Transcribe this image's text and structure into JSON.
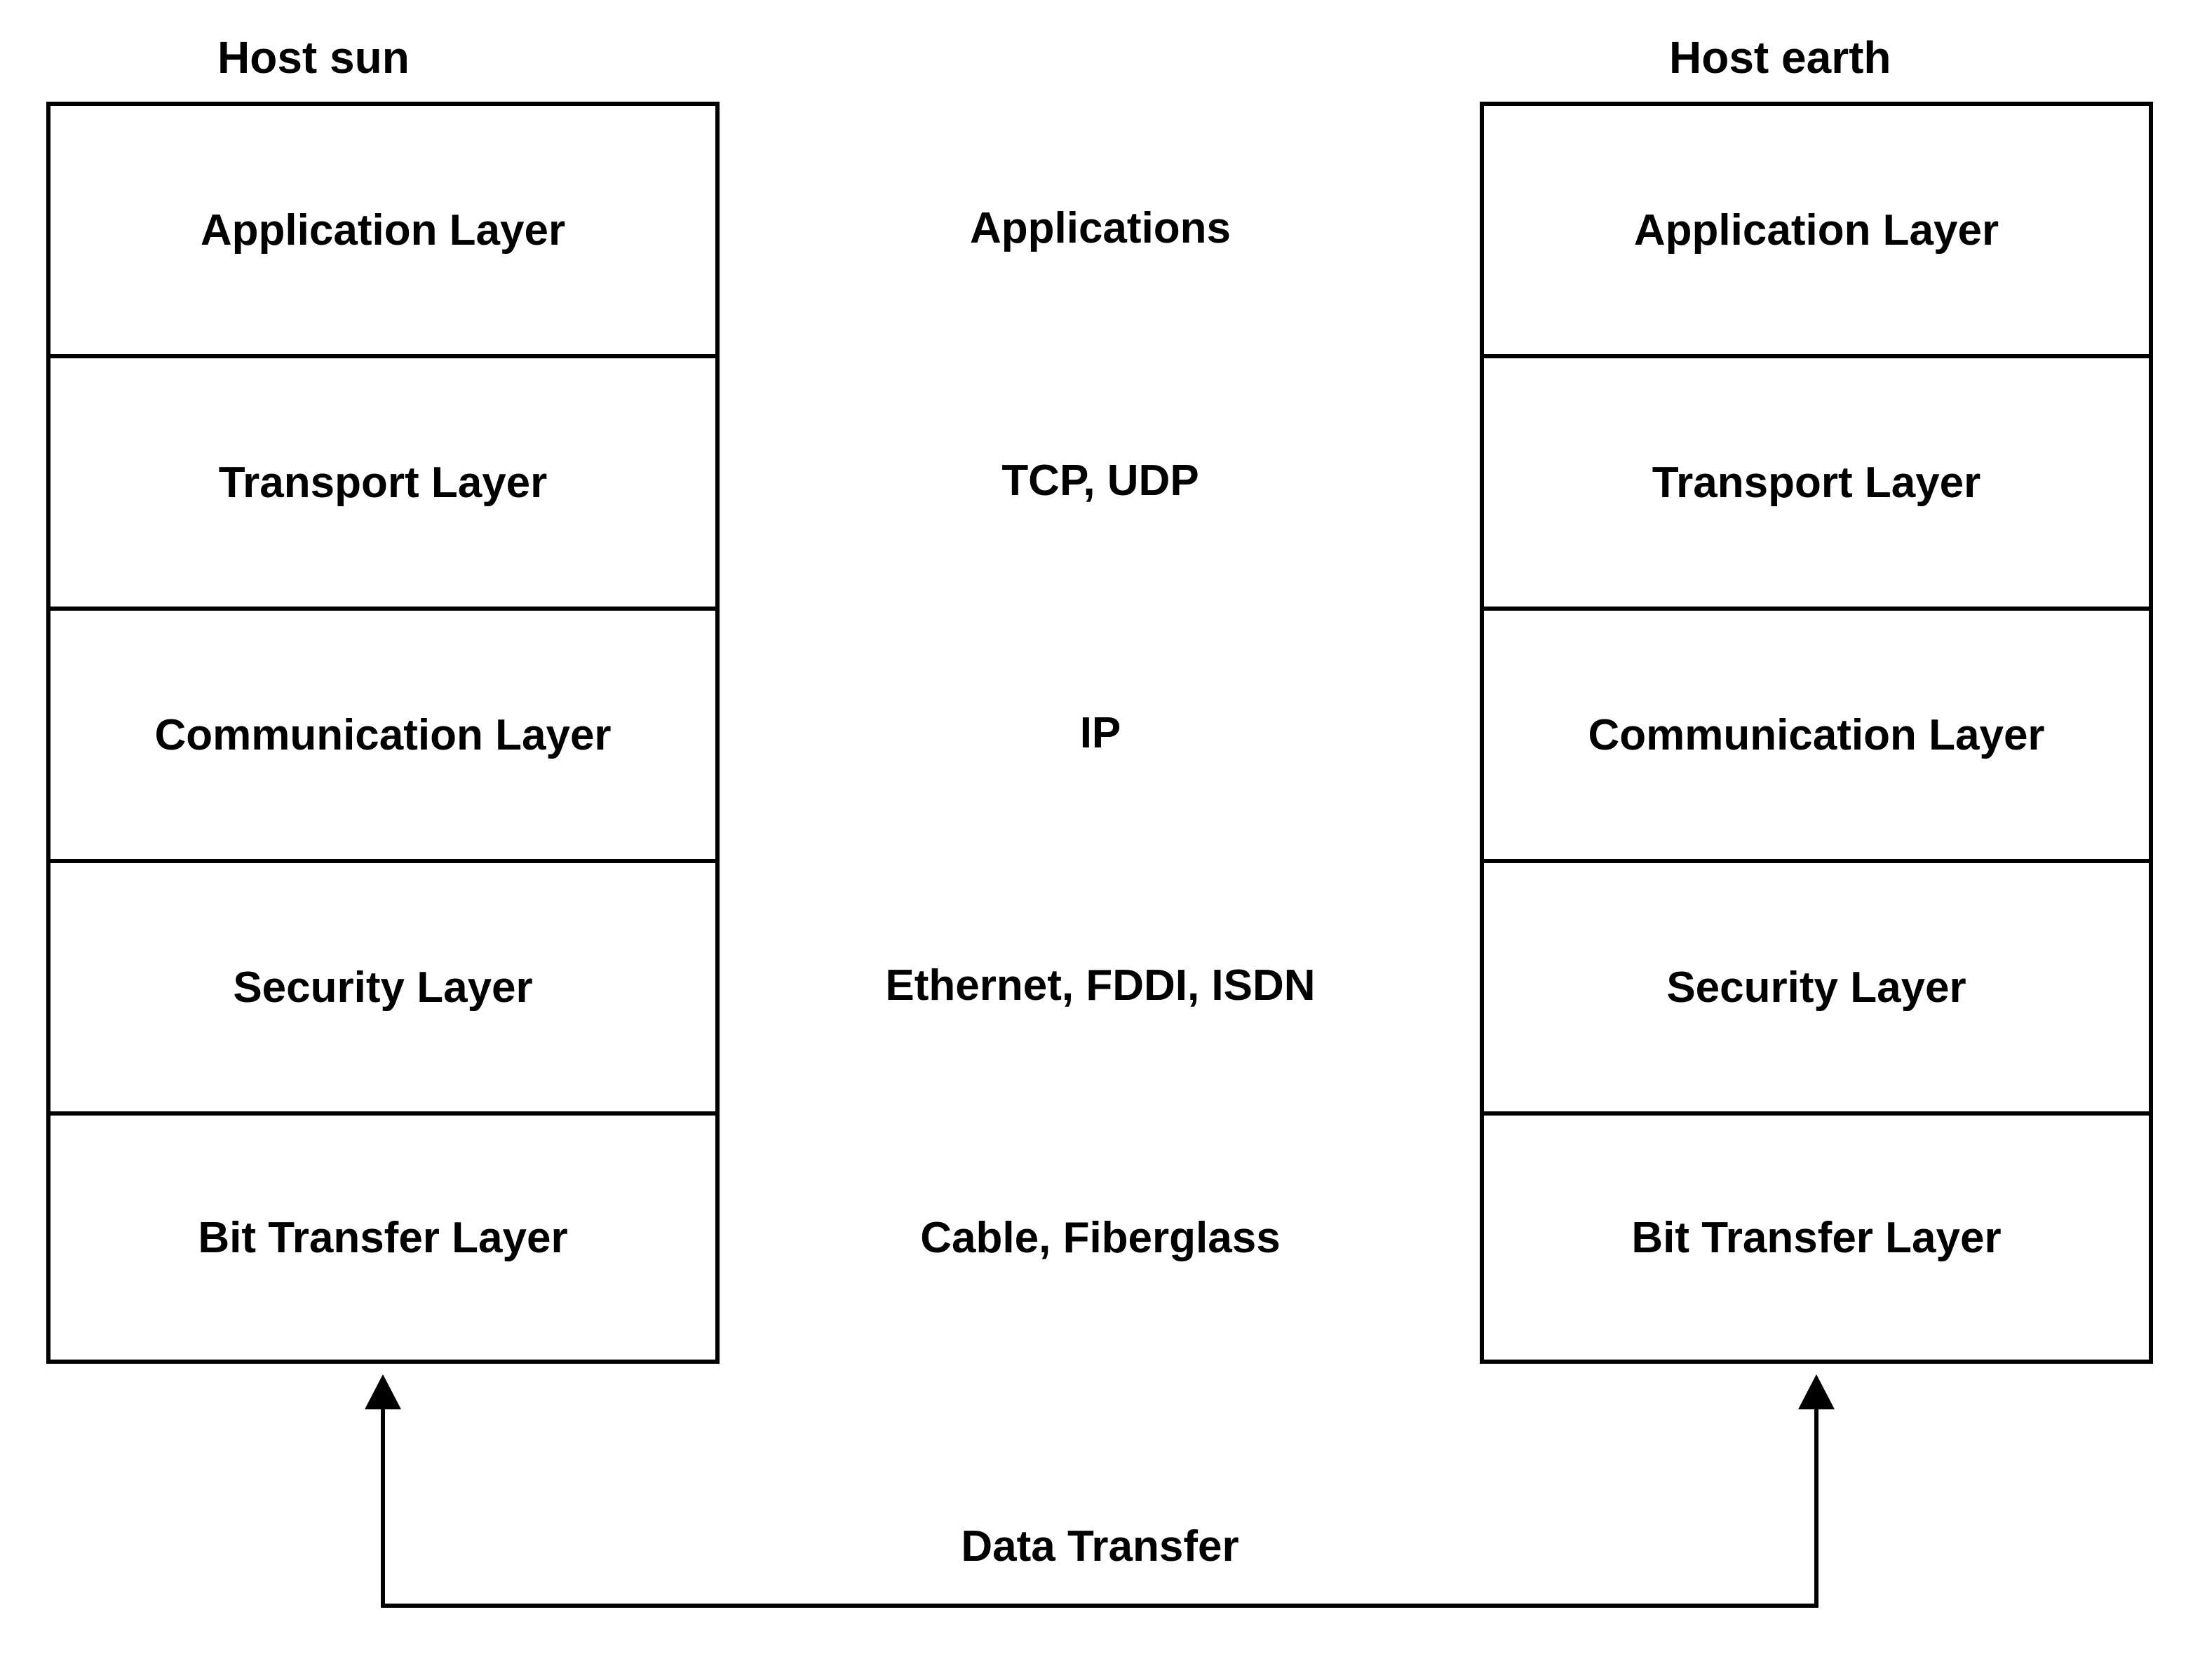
{
  "hosts": {
    "left": {
      "title": "Host sun"
    },
    "right": {
      "title": "Host earth"
    }
  },
  "layers": [
    "Application Layer",
    "Transport Layer",
    "Communication Layer",
    "Security Layer",
    "Bit Transfer Layer"
  ],
  "middle": [
    "Applications",
    "TCP, UDP",
    "IP",
    "Ethernet, FDDI, ISDN",
    "Cable, Fiberglass"
  ],
  "bottom_label": "Data Transfer"
}
